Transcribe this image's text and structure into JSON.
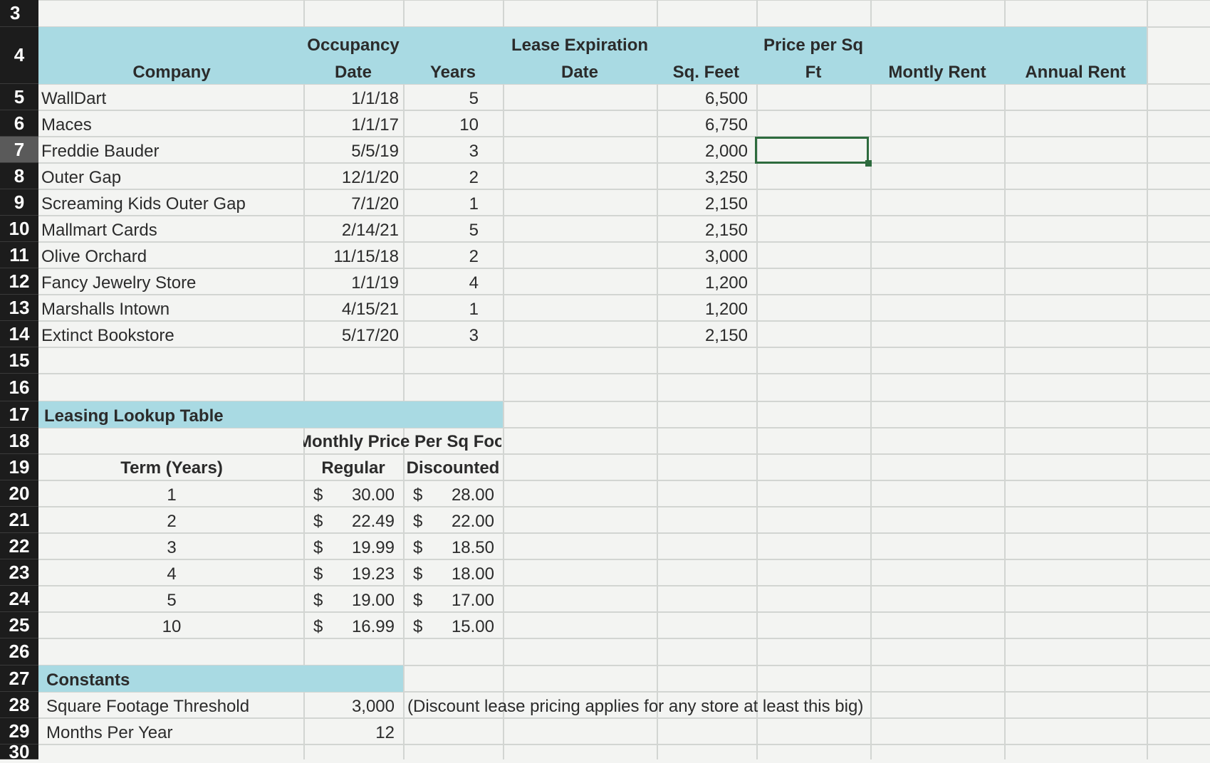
{
  "row_numbers": [
    "3",
    "4",
    "5",
    "6",
    "7",
    "8",
    "9",
    "10",
    "11",
    "12",
    "13",
    "14",
    "15",
    "16",
    "17",
    "18",
    "19",
    "20",
    "21",
    "22",
    "23",
    "24",
    "25",
    "26",
    "27",
    "28",
    "29",
    "30"
  ],
  "headers": {
    "company": "Company",
    "occupancy_line1": "Occupancy",
    "occupancy_line2": "Date",
    "years": "Years",
    "lease_exp_line1": "Lease Expiration",
    "lease_exp_line2": "Date",
    "sq_feet": "Sq. Feet",
    "price_line1": "Price per Sq",
    "price_line2": "Ft",
    "monthly_rent": "Montly Rent",
    "annual_rent": "Annual Rent"
  },
  "tenants": [
    {
      "company": "WallDart",
      "occupancy": "1/1/18",
      "years": "5",
      "sqft": "6,500"
    },
    {
      "company": "Maces",
      "occupancy": "1/1/17",
      "years": "10",
      "sqft": "6,750"
    },
    {
      "company": "Freddie Bauder",
      "occupancy": "5/5/19",
      "years": "3",
      "sqft": "2,000"
    },
    {
      "company": "Outer Gap",
      "occupancy": "12/1/20",
      "years": "2",
      "sqft": "3,250"
    },
    {
      "company": "Screaming Kids Outer Gap",
      "occupancy": "7/1/20",
      "years": "1",
      "sqft": "2,150"
    },
    {
      "company": "Mallmart Cards",
      "occupancy": "2/14/21",
      "years": "5",
      "sqft": "2,150"
    },
    {
      "company": "Olive Orchard",
      "occupancy": "11/15/18",
      "years": "2",
      "sqft": "3,000"
    },
    {
      "company": "Fancy Jewelry Store",
      "occupancy": "1/1/19",
      "years": "4",
      "sqft": "1,200"
    },
    {
      "company": "Marshalls Intown",
      "occupancy": "4/15/21",
      "years": "1",
      "sqft": "1,200"
    },
    {
      "company": "Extinct Bookstore",
      "occupancy": "5/17/20",
      "years": "3",
      "sqft": "2,150"
    }
  ],
  "lookup": {
    "title": "Leasing Lookup Table",
    "price_header": "Monthly Price Per Sq Foo",
    "term_header": "Term (Years)",
    "regular_header": "Regular",
    "discounted_header": "Discounted",
    "currency": "$",
    "rows": [
      {
        "term": "1",
        "regular": "30.00",
        "discounted": "28.00"
      },
      {
        "term": "2",
        "regular": "22.49",
        "discounted": "22.00"
      },
      {
        "term": "3",
        "regular": "19.99",
        "discounted": "18.50"
      },
      {
        "term": "4",
        "regular": "19.23",
        "discounted": "18.00"
      },
      {
        "term": "5",
        "regular": "19.00",
        "discounted": "17.00"
      },
      {
        "term": "10",
        "regular": "16.99",
        "discounted": "15.00"
      }
    ]
  },
  "constants": {
    "title": "Constants",
    "threshold_label": "Square Footage Threshold",
    "threshold_value": "3,000",
    "threshold_note": "(Discount lease pricing applies for any store at least this big)",
    "months_label": "Months Per Year",
    "months_value": "12"
  },
  "colors": {
    "header_band": "#a9dae3",
    "selection": "#2d6b3e",
    "row_header_bg": "#1c1c1c"
  }
}
